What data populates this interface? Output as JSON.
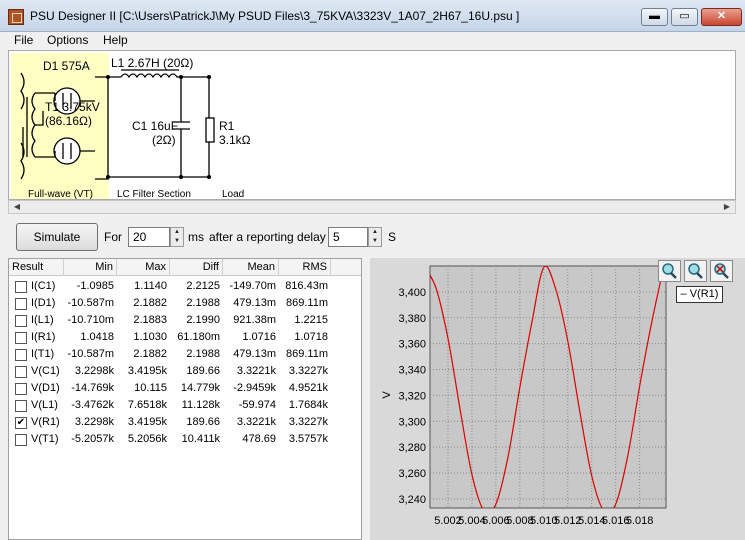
{
  "title": "PSU Designer II  [C:\\Users\\PatrickJ\\My PSUD Files\\3_75KVA\\3323V_1A07_2H67_16U.psu ]",
  "window_controls": {
    "min": "▬",
    "max": "▭",
    "close": "✕"
  },
  "menu": [
    "File",
    "Options",
    "Help"
  ],
  "schematic": {
    "diode": "D1 575A",
    "transformer": "T1 3.75kV",
    "transformer_res": "(86.16Ω)",
    "inductor": "L1 2.67H (20Ω)",
    "capacitor": "C1 16uF",
    "capacitor_res": "(2Ω)",
    "resistor": "R1",
    "resistor_val": "3.1kΩ",
    "section_rect": "Full-wave (VT)",
    "section_lc": "LC Filter Section",
    "section_load": "Load"
  },
  "controls": {
    "simulate": "Simulate",
    "for": "For",
    "duration": "20",
    "ms": "ms",
    "after": "after a reporting delay of",
    "delay": "5",
    "s": "S"
  },
  "table": {
    "headers": [
      "Result",
      "Min",
      "Max",
      "Diff",
      "Mean",
      "RMS"
    ],
    "rows": [
      {
        "name": "I(C1)",
        "checked": false,
        "min": "-1.0985",
        "max": "1.1140",
        "diff": "2.2125",
        "mean": "-149.70m",
        "rms": "816.43m"
      },
      {
        "name": "I(D1)",
        "checked": false,
        "min": "-10.587m",
        "max": "2.1882",
        "diff": "2.1988",
        "mean": "479.13m",
        "rms": "869.11m"
      },
      {
        "name": "I(L1)",
        "checked": false,
        "min": "-10.710m",
        "max": "2.1883",
        "diff": "2.1990",
        "mean": "921.38m",
        "rms": "1.2215"
      },
      {
        "name": "I(R1)",
        "checked": false,
        "min": "1.0418",
        "max": "1.1030",
        "diff": "61.180m",
        "mean": "1.0716",
        "rms": "1.0718"
      },
      {
        "name": "I(T1)",
        "checked": false,
        "min": "-10.587m",
        "max": "2.1882",
        "diff": "2.1988",
        "mean": "479.13m",
        "rms": "869.11m"
      },
      {
        "name": "V(C1)",
        "checked": false,
        "min": "3.2298k",
        "max": "3.4195k",
        "diff": "189.66",
        "mean": "3.3221k",
        "rms": "3.3227k"
      },
      {
        "name": "V(D1)",
        "checked": false,
        "min": "-14.769k",
        "max": "10.115",
        "diff": "14.779k",
        "mean": "-2.9459k",
        "rms": "4.9521k"
      },
      {
        "name": "V(L1)",
        "checked": false,
        "min": "-3.4762k",
        "max": "7.6518k",
        "diff": "11.128k",
        "mean": "-59.974",
        "rms": "1.7684k"
      },
      {
        "name": "V(R1)",
        "checked": true,
        "min": "3.2298k",
        "max": "3.4195k",
        "diff": "189.66",
        "mean": "3.3221k",
        "rms": "3.3227k"
      },
      {
        "name": "V(T1)",
        "checked": false,
        "min": "-5.2057k",
        "max": "5.2056k",
        "diff": "10.411k",
        "mean": "478.69",
        "rms": "3.5757k"
      }
    ]
  },
  "graph": {
    "legend": "– V(R1)",
    "ylabel": "V",
    "line_color": "#dd0000"
  },
  "chart_data": {
    "type": "line",
    "xlabel": "",
    "ylabel": "V",
    "xlim": [
      5.0005,
      5.0202
    ],
    "ylim": [
      3233,
      3420
    ],
    "grid": true,
    "x_ticks": [
      5.002,
      5.004,
      5.006,
      5.008,
      5.01,
      5.012,
      5.014,
      5.016,
      5.018
    ],
    "x_tick_labels": [
      "5.002",
      "5.004",
      "5.006",
      "5.008",
      "5.010",
      "5.012",
      "5.014",
      "5.016",
      "5.018"
    ],
    "y_ticks": [
      3240,
      3260,
      3280,
      3300,
      3320,
      3340,
      3360,
      3380,
      3400
    ],
    "y_tick_labels": [
      "3,240",
      "3,260",
      "3,280",
      "3,300",
      "3,320",
      "3,340",
      "3,360",
      "3,380",
      "3,400"
    ],
    "series": [
      {
        "name": "V(R1)",
        "color": "#dd0000",
        "x": [
          5.0,
          5.001,
          5.002,
          5.003,
          5.004,
          5.005,
          5.006,
          5.007,
          5.008,
          5.009,
          5.01,
          5.011,
          5.012,
          5.013,
          5.014,
          5.015,
          5.016,
          5.017,
          5.018,
          5.019,
          5.02
        ],
        "y": [
          3420,
          3403,
          3364,
          3310,
          3259,
          3231,
          3236,
          3272,
          3326,
          3376,
          3419,
          3402,
          3362,
          3308,
          3258,
          3231,
          3236,
          3273,
          3327,
          3376,
          3419
        ]
      }
    ]
  }
}
